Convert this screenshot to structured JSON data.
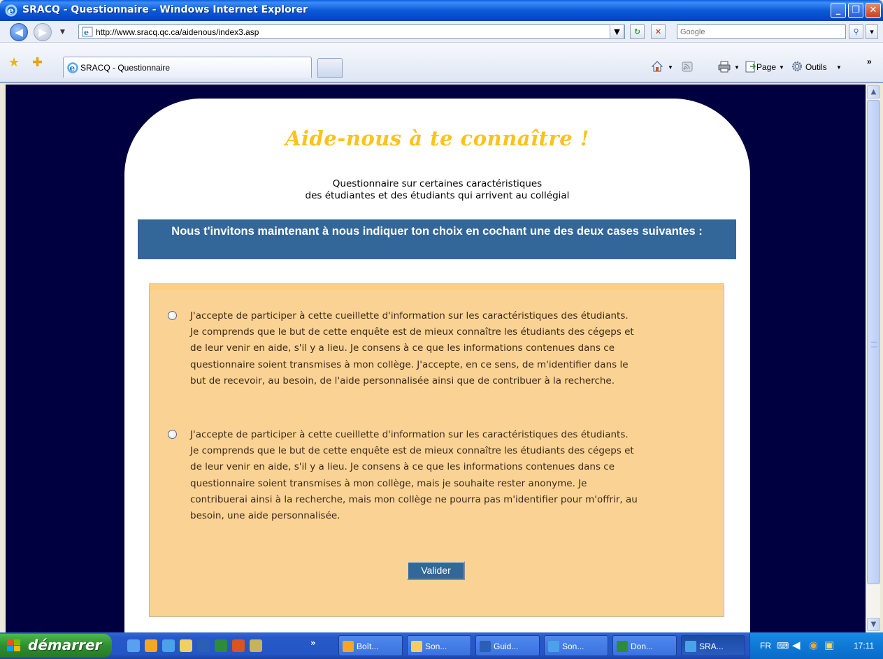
{
  "window": {
    "title": "SRACQ - Questionnaire - Windows Internet Explorer",
    "minimize": "_",
    "maximize": "❐",
    "close": "✕"
  },
  "addressbar": {
    "url": "http://www.sracq.qc.ca/aidenous/index3.asp",
    "search_placeholder": "Google"
  },
  "tabs": {
    "active_label": "SRACQ - Questionnaire"
  },
  "commandbar": {
    "page_label": "Page",
    "tools_label": "Outils"
  },
  "page": {
    "heading": "Aide-nous à te connaître !",
    "subheading_line1": "Questionnaire sur certaines caractéristiques",
    "subheading_line2": "des étudiantes et des étudiants qui arrivent au collégial",
    "banner": "Nous t'invitons maintenant à nous indiquer ton choix en cochant une des deux cases suivantes :",
    "options": [
      {
        "text": "J'accepte de participer à cette cueillette d'information sur les caractéristiques des étudiants. Je comprends que le but de cette enquête est de mieux connaître les étudiants des cégeps et de leur venir en aide, s'il y a lieu. Je consens à ce que les informations contenues dans ce questionnaire soient transmises à mon collège. J'accepte, en ce sens, de m'identifier dans le but de recevoir, au besoin, de l'aide personnalisée ainsi que de contribuer à la recherche."
      },
      {
        "text": "J'accepte de participer à cette cueillette d'information sur les caractéristiques des étudiants. Je comprends que le but de cette enquête est de mieux connaître les étudiants des cégeps et de leur venir en aide, s'il y a lieu. Je consens à ce que les informations contenues dans ce questionnaire soient transmises à mon collège, mais je souhaite rester anonyme. Je contribuerai ainsi à la recherche, mais mon collège ne pourra pas m'identifier pour m'offrir, au besoin, une aide personnalisée."
      }
    ],
    "submit_label": "Valider"
  },
  "taskbar": {
    "start_label": "démarrer",
    "chevron": "»",
    "tasks": [
      {
        "label": "Boît...",
        "icon": "outlook-icon",
        "color": "#f5a623"
      },
      {
        "label": "Son...",
        "icon": "folder-icon",
        "color": "#f0d060"
      },
      {
        "label": "Guid...",
        "icon": "word-icon",
        "color": "#2b5fb4"
      },
      {
        "label": "Son...",
        "icon": "ie-icon",
        "color": "#4aa3e8"
      },
      {
        "label": "Don...",
        "icon": "excel-icon",
        "color": "#2e8b3a"
      },
      {
        "label": "SRA...",
        "icon": "ie-icon",
        "color": "#4aa3e8"
      }
    ],
    "tray": {
      "language": "FR",
      "clock": "17:11"
    }
  },
  "colors": {
    "page_background": "#000040",
    "heading": "#ffc21a",
    "banner": "#336699",
    "form_background": "#fad394"
  }
}
